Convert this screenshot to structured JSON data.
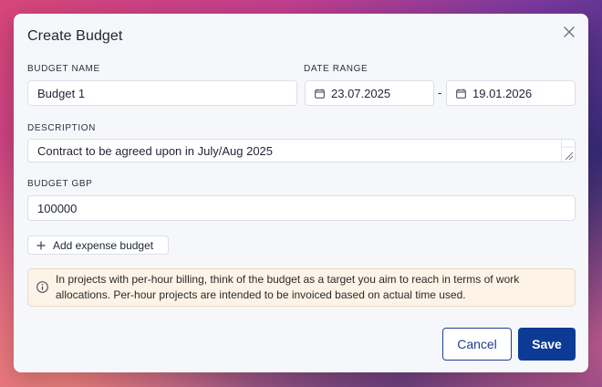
{
  "dialog": {
    "title": "Create Budget",
    "close_icon": "close-icon"
  },
  "form": {
    "budget_name": {
      "label": "BUDGET NAME",
      "value": "Budget 1"
    },
    "date_range": {
      "label": "DATE RANGE",
      "start": "23.07.2025",
      "separator": "-",
      "end": "19.01.2026",
      "icon": "calendar-icon"
    },
    "description": {
      "label": "DESCRIPTION",
      "value": "Contract to be agreed upon in July/Aug 2025"
    },
    "budget_gbp": {
      "label": "BUDGET GBP",
      "value": "100000"
    },
    "add_expense": {
      "label": "Add expense budget",
      "icon": "plus-icon"
    }
  },
  "info_box": {
    "icon": "info-icon",
    "text": "In projects with per-hour billing, think of the budget as a target you aim to reach in terms of work allocations. Per-hour projects are intended to be invoiced based on actual time used."
  },
  "actions": {
    "cancel_label": "Cancel",
    "save_label": "Save"
  },
  "colors": {
    "primary": "#0d3a94",
    "info_bg": "#fdf3e6"
  }
}
